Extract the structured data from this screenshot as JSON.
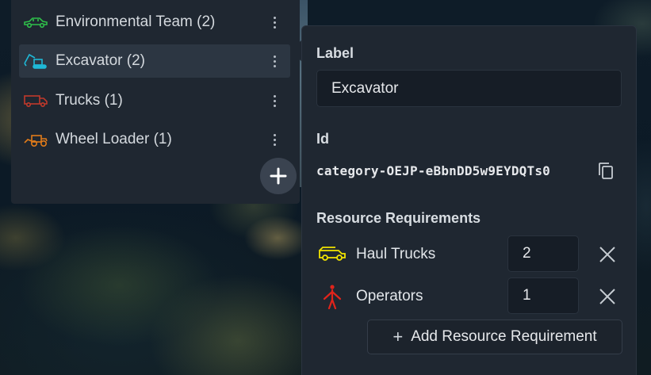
{
  "categories": [
    {
      "label": "Environmental Team (2)",
      "icon": "car-icon",
      "color": "#2fbf4a",
      "active": false
    },
    {
      "label": "Excavator (2)",
      "icon": "excavator-icon",
      "color": "#1fb8d6",
      "active": true
    },
    {
      "label": "Trucks (1)",
      "icon": "truck-icon",
      "color": "#c0392b",
      "active": false
    },
    {
      "label": "Wheel Loader (1)",
      "icon": "wheel-loader-icon",
      "color": "#e07b1a",
      "active": false
    }
  ],
  "details": {
    "label_heading": "Label",
    "label_value": "Excavator",
    "id_heading": "Id",
    "id_value": "category-OEJP-eBbnDD5w9EYDQTs0",
    "requirements_heading": "Resource Requirements",
    "requirements": [
      {
        "name": "Haul Trucks",
        "quantity": "2",
        "icon": "haul-truck-icon",
        "color": "#f2e400"
      },
      {
        "name": "Operators",
        "quantity": "1",
        "icon": "operator-icon",
        "color": "#e0241b"
      }
    ],
    "add_requirement_label": "Add Resource Requirement"
  },
  "colors": {
    "panel": "#1f2731",
    "active_item": "#2c3642",
    "input_bg": "#161d26"
  }
}
